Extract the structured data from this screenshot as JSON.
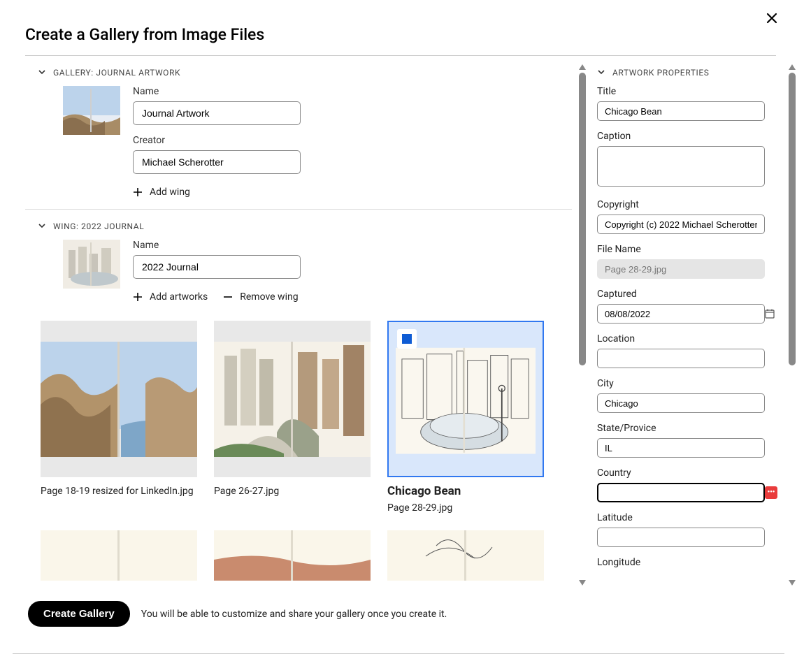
{
  "modal": {
    "title": "Create a Gallery from Image Files"
  },
  "gallery_section": {
    "header": "GALLERY: JOURNAL ARTWORK",
    "name_label": "Name",
    "name_value": "Journal Artwork",
    "creator_label": "Creator",
    "creator_value": "Michael Scherotter",
    "add_wing_label": "Add wing"
  },
  "wing_section": {
    "header": "WING: 2022 JOURNAL",
    "name_label": "Name",
    "name_value": "2022 Journal",
    "add_artworks_label": "Add artworks",
    "remove_wing_label": "Remove wing"
  },
  "artworks": [
    {
      "label": "Page 18-19 resized for LinkedIn.jpg",
      "selected": false
    },
    {
      "label": "Page 26-27.jpg",
      "selected": false
    },
    {
      "name": "Chicago Bean",
      "label": "Page 28-29.jpg",
      "selected": true
    }
  ],
  "properties": {
    "header": "ARTWORK PROPERTIES",
    "title_label": "Title",
    "title_value": "Chicago Bean",
    "caption_label": "Caption",
    "caption_value": "",
    "copyright_label": "Copyright",
    "copyright_value": "Copyright (c) 2022 Michael Scherotter",
    "filename_label": "File Name",
    "filename_value": "Page 28-29.jpg",
    "captured_label": "Captured",
    "captured_value": "08/08/2022",
    "location_label": "Location",
    "location_value": "",
    "city_label": "City",
    "city_value": "Chicago",
    "state_label": "State/Provice",
    "state_value": "IL",
    "country_label": "Country",
    "country_value": "",
    "latitude_label": "Latitude",
    "latitude_value": "",
    "longitude_label": "Longitude",
    "longitude_value": ""
  },
  "footer": {
    "button": "Create Gallery",
    "hint": "You will be able to customize and share your gallery once you create it."
  }
}
